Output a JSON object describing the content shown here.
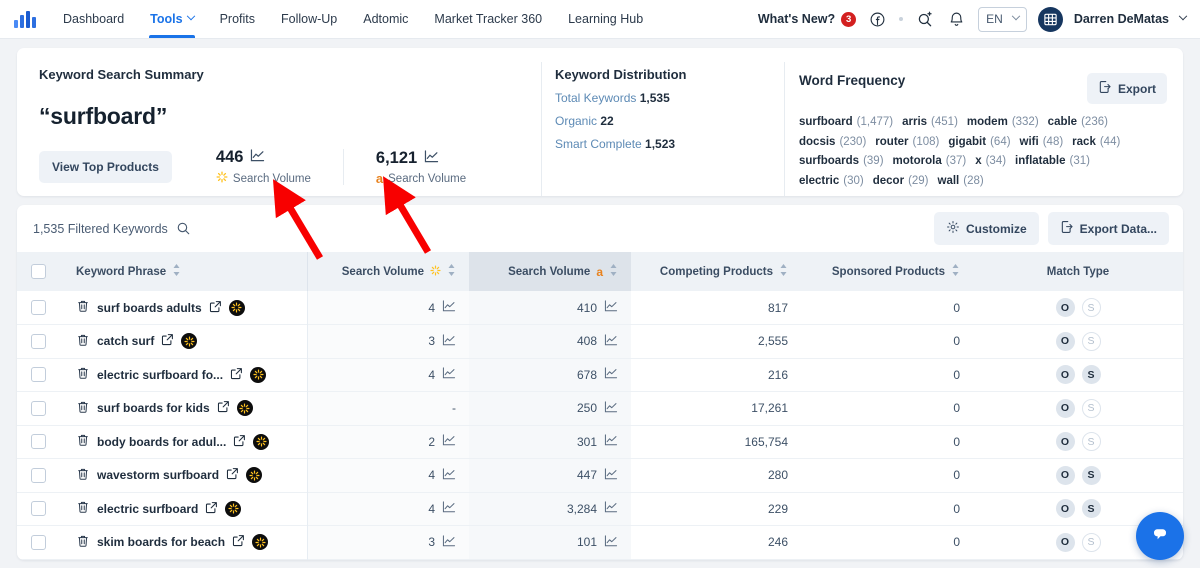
{
  "navbar": {
    "logo_icon": "bar-chart-logo-icon",
    "items": [
      {
        "label": "Dashboard",
        "active": false,
        "caret": false
      },
      {
        "label": "Tools",
        "active": true,
        "caret": true
      },
      {
        "label": "Profits",
        "active": false,
        "caret": false
      },
      {
        "label": "Follow-Up",
        "active": false,
        "caret": false
      },
      {
        "label": "Adtomic",
        "active": false,
        "caret": false
      },
      {
        "label": "Market Tracker 360",
        "active": false,
        "caret": false
      },
      {
        "label": "Learning Hub",
        "active": false,
        "caret": false
      }
    ],
    "whats_new_label": "What's New?",
    "whats_new_count": "3",
    "facebook_icon": "facebook-icon",
    "search_icon": "search-sparkle-icon",
    "bell_icon": "notification-bell-icon",
    "language": "EN",
    "user_name": "Darren DeMatas"
  },
  "summary": {
    "title": "Keyword Search Summary",
    "keyword": "“surfboard”",
    "top_products_button": "View Top Products",
    "metrics": [
      {
        "value": "446",
        "label": "Search Volume",
        "source": "walmart"
      },
      {
        "value": "6,121",
        "label": "Search Volume",
        "source": "amazon"
      }
    ]
  },
  "distribution": {
    "title": "Keyword Distribution",
    "rows": [
      {
        "label": "Total Keywords",
        "value": "1,535"
      },
      {
        "label": "Organic",
        "value": "22"
      },
      {
        "label": "Smart Complete",
        "value": "1,523"
      }
    ]
  },
  "word_frequency": {
    "title": "Word Frequency",
    "export_label": "Export",
    "rows": [
      [
        {
          "term": "surfboard",
          "count": "(1,477)"
        },
        {
          "term": "arris",
          "count": "(451)"
        },
        {
          "term": "modem",
          "count": "(332)"
        },
        {
          "term": "cable",
          "count": "(236)"
        }
      ],
      [
        {
          "term": "docsis",
          "count": "(230)"
        },
        {
          "term": "router",
          "count": "(108)"
        },
        {
          "term": "gigabit",
          "count": "(64)"
        },
        {
          "term": "wifi",
          "count": "(48)"
        },
        {
          "term": "rack",
          "count": "(44)"
        }
      ],
      [
        {
          "term": "surfboards",
          "count": "(39)"
        },
        {
          "term": "motorola",
          "count": "(37)"
        },
        {
          "term": "x",
          "count": "(34)"
        },
        {
          "term": "inflatable",
          "count": "(31)"
        }
      ],
      [
        {
          "term": "electric",
          "count": "(30)"
        },
        {
          "term": "decor",
          "count": "(29)"
        },
        {
          "term": "wall",
          "count": "(28)"
        }
      ]
    ]
  },
  "toolbar": {
    "filtered_keywords": "1,535 Filtered Keywords",
    "search_icon": "search-icon",
    "customize_label": "Customize",
    "export_data_label": "Export Data..."
  },
  "table": {
    "headers": {
      "keyword_phrase": "Keyword Phrase",
      "search_volume_walmart": "Search Volume",
      "search_volume_amazon": "Search Volume",
      "competing_products": "Competing Products",
      "sponsored_products": "Sponsored Products",
      "match_type": "Match Type"
    },
    "rows": [
      {
        "keyword": "surf boards adults",
        "sv_walmart": "4",
        "sv_walmart_chart": true,
        "sv_amazon": "410",
        "competing": "817",
        "sponsored": "0",
        "organic": true,
        "sponsored_match": false
      },
      {
        "keyword": "catch surf",
        "sv_walmart": "3",
        "sv_walmart_chart": true,
        "sv_amazon": "408",
        "competing": "2,555",
        "sponsored": "0",
        "organic": true,
        "sponsored_match": false
      },
      {
        "keyword": "electric surfboard fo...",
        "sv_walmart": "4",
        "sv_walmart_chart": true,
        "sv_amazon": "678",
        "competing": "216",
        "sponsored": "0",
        "organic": true,
        "sponsored_match": true
      },
      {
        "keyword": "surf boards for kids",
        "sv_walmart": "-",
        "sv_walmart_chart": false,
        "sv_amazon": "250",
        "competing": "17,261",
        "sponsored": "0",
        "organic": true,
        "sponsored_match": false
      },
      {
        "keyword": "body boards for adul...",
        "sv_walmart": "2",
        "sv_walmart_chart": true,
        "sv_amazon": "301",
        "competing": "165,754",
        "sponsored": "0",
        "organic": true,
        "sponsored_match": false
      },
      {
        "keyword": "wavestorm surfboard",
        "sv_walmart": "4",
        "sv_walmart_chart": true,
        "sv_amazon": "447",
        "competing": "280",
        "sponsored": "0",
        "organic": true,
        "sponsored_match": true
      },
      {
        "keyword": "electric surfboard",
        "sv_walmart": "4",
        "sv_walmart_chart": true,
        "sv_amazon": "3,284",
        "competing": "229",
        "sponsored": "0",
        "organic": true,
        "sponsored_match": true
      },
      {
        "keyword": "skim boards for beach",
        "sv_walmart": "3",
        "sv_walmart_chart": true,
        "sv_amazon": "101",
        "competing": "246",
        "sponsored": "0",
        "organic": true,
        "sponsored_match": false
      }
    ],
    "match_organic_label": "O",
    "match_sponsored_label": "S"
  },
  "annotations": {
    "arrow_color": "#f80000",
    "arrow_count": 2
  },
  "chat": {
    "icon": "chat-bubble-icon"
  },
  "colors": {
    "accent": "#1a73e8",
    "walmart_yellow": "#ffc220",
    "amazon_orange": "#e8821e",
    "badge_red": "#d32020",
    "avatar_navy": "#16365f"
  }
}
